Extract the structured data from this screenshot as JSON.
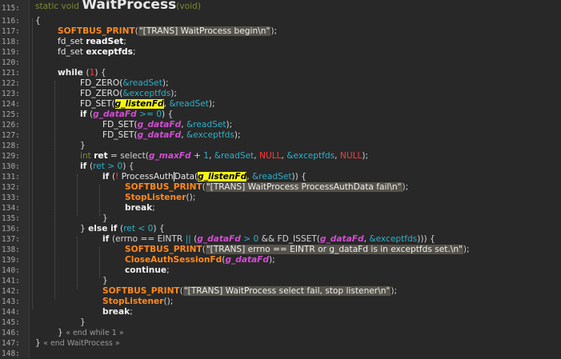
{
  "editor": {
    "colors": {
      "background": "#282828",
      "macro": "#ff8a1e",
      "global_var": "#d24dd2",
      "address": "#2eb0c9",
      "null": "#ff3a3a",
      "highlight": "#f5f513"
    },
    "lines": [
      {
        "num": "115:",
        "indent": 0,
        "tokens": [
          [
            "tk",
            "static void "
          ],
          [
            "fn",
            "WaitProcess"
          ],
          [
            "tk",
            "(void)"
          ]
        ]
      },
      {
        "num": "116:",
        "indent": 0,
        "tokens": [
          [
            "p",
            "{"
          ]
        ]
      },
      {
        "num": "117:",
        "indent": 1,
        "tokens": [
          [
            "m",
            "SOFTBUS_PRINT"
          ],
          [
            "p",
            "("
          ],
          [
            "s",
            "\"[TRANS] WaitProcess begin\\n\""
          ],
          [
            "p",
            ");"
          ]
        ]
      },
      {
        "num": "118:",
        "indent": 1,
        "tokens": [
          [
            "t",
            "fd_set "
          ],
          [
            "v",
            "readSet"
          ],
          [
            "p",
            ";"
          ]
        ]
      },
      {
        "num": "119:",
        "indent": 1,
        "tokens": [
          [
            "t",
            "fd_set "
          ],
          [
            "v",
            "exceptfds"
          ],
          [
            "p",
            ";"
          ]
        ]
      },
      {
        "num": "120:",
        "indent": 0,
        "tokens": []
      },
      {
        "num": "121:",
        "indent": 1,
        "tokens": [
          [
            "k",
            "while "
          ],
          [
            "p",
            "("
          ],
          [
            "n",
            "1"
          ],
          [
            "p",
            ") {"
          ]
        ]
      },
      {
        "num": "122:",
        "indent": 2,
        "tokens": [
          [
            "t",
            "FD_ZERO("
          ],
          [
            "a",
            "&readSet"
          ],
          [
            "p",
            ");"
          ]
        ]
      },
      {
        "num": "123:",
        "indent": 2,
        "tokens": [
          [
            "t",
            "FD_ZERO("
          ],
          [
            "a",
            "&exceptfds"
          ],
          [
            "p",
            ");"
          ]
        ]
      },
      {
        "num": "124:",
        "indent": 2,
        "tokens": [
          [
            "t",
            "FD_SET("
          ],
          [
            "hl-g",
            "g_listenFd"
          ],
          [
            "p",
            ", "
          ],
          [
            "a",
            "&readSet"
          ],
          [
            "p",
            ");"
          ]
        ]
      },
      {
        "num": "125:",
        "indent": 2,
        "tokens": [
          [
            "k",
            "if "
          ],
          [
            "p",
            "("
          ],
          [
            "g",
            "g_dataFd"
          ],
          [
            "a",
            " >= 0"
          ],
          [
            "p",
            ") {"
          ]
        ]
      },
      {
        "num": "126:",
        "indent": 3,
        "tokens": [
          [
            "t",
            "FD_SET("
          ],
          [
            "g",
            "g_dataFd"
          ],
          [
            "p",
            ", "
          ],
          [
            "a",
            "&readSet"
          ],
          [
            "p",
            ");"
          ]
        ]
      },
      {
        "num": "127:",
        "indent": 3,
        "tokens": [
          [
            "t",
            "FD_SET("
          ],
          [
            "g",
            "g_dataFd"
          ],
          [
            "p",
            ", "
          ],
          [
            "a",
            "&exceptfds"
          ],
          [
            "p",
            ");"
          ]
        ]
      },
      {
        "num": "128:",
        "indent": 2,
        "tokens": [
          [
            "p",
            "}"
          ]
        ]
      },
      {
        "num": "129:",
        "indent": 2,
        "tokens": [
          [
            "tk",
            "int "
          ],
          [
            "v",
            "ret"
          ],
          [
            "p",
            " = select("
          ],
          [
            "g",
            "g_maxFd"
          ],
          [
            "p",
            " + "
          ],
          [
            "a",
            "1"
          ],
          [
            "p",
            ", "
          ],
          [
            "a",
            "&readSet"
          ],
          [
            "p",
            ", "
          ],
          [
            "n",
            "NULL"
          ],
          [
            "p",
            ", "
          ],
          [
            "a",
            "&exceptfds"
          ],
          [
            "p",
            ", "
          ],
          [
            "n",
            "NULL"
          ],
          [
            "p",
            ");"
          ]
        ]
      },
      {
        "num": "130:",
        "indent": 2,
        "tokens": [
          [
            "k",
            "if "
          ],
          [
            "p",
            "("
          ],
          [
            "a",
            "ret > 0"
          ],
          [
            "p",
            ") {"
          ]
        ]
      },
      {
        "num": "131:",
        "indent": 3,
        "tokens": [
          [
            "k",
            "if "
          ],
          [
            "p",
            "("
          ],
          [
            "n",
            "! "
          ],
          [
            "pd",
            "ProcessAuth"
          ],
          [
            "caret",
            ""
          ],
          [
            "pd",
            "Data("
          ],
          [
            "hl-g",
            "g_listenFd"
          ],
          [
            "p",
            ", "
          ],
          [
            "a",
            "&readSet"
          ],
          [
            "p",
            ")) {"
          ]
        ]
      },
      {
        "num": "132:",
        "indent": 4,
        "tokens": [
          [
            "m",
            "SOFTBUS_PRINT"
          ],
          [
            "p",
            "("
          ],
          [
            "s",
            "\"[TRANS] WaitProcess ProcessAuthData fail\\n\""
          ],
          [
            "p",
            ");"
          ]
        ]
      },
      {
        "num": "133:",
        "indent": 4,
        "tokens": [
          [
            "m",
            "StopListener"
          ],
          [
            "p",
            "();"
          ]
        ]
      },
      {
        "num": "134:",
        "indent": 4,
        "tokens": [
          [
            "k",
            "break"
          ],
          [
            "p",
            ";"
          ]
        ]
      },
      {
        "num": "135:",
        "indent": 3,
        "tokens": [
          [
            "p",
            "}"
          ]
        ]
      },
      {
        "num": "136:",
        "indent": 2,
        "tokens": [
          [
            "p",
            "} "
          ],
          [
            "k",
            "else if "
          ],
          [
            "p",
            "("
          ],
          [
            "a",
            "ret < 0"
          ],
          [
            "p",
            ") {"
          ]
        ]
      },
      {
        "num": "137:",
        "indent": 3,
        "tokens": [
          [
            "k",
            "if "
          ],
          [
            "p",
            "(errno == EINTR "
          ],
          [
            "a",
            "|| "
          ],
          [
            "p",
            "("
          ],
          [
            "g",
            "g_dataFd"
          ],
          [
            "a",
            " > 0 "
          ],
          [
            "p",
            "&& FD_ISSET("
          ],
          [
            "g",
            "g_dataFd"
          ],
          [
            "p",
            ", "
          ],
          [
            "a",
            "&exceptfds"
          ],
          [
            "p",
            "))) {"
          ]
        ]
      },
      {
        "num": "138:",
        "indent": 4,
        "tokens": [
          [
            "m",
            "SOFTBUS_PRINT"
          ],
          [
            "p",
            "("
          ],
          [
            "s",
            "\"[TRANS] errno == EINTR or g_dataFd is in exceptfds set.\\n\""
          ],
          [
            "p",
            ");"
          ]
        ]
      },
      {
        "num": "139:",
        "indent": 4,
        "tokens": [
          [
            "m",
            "CloseAuthSessionFd"
          ],
          [
            "p",
            "("
          ],
          [
            "g",
            "g_dataFd"
          ],
          [
            "p",
            ");"
          ]
        ]
      },
      {
        "num": "140:",
        "indent": 4,
        "tokens": [
          [
            "k",
            "continue"
          ],
          [
            "p",
            ";"
          ]
        ]
      },
      {
        "num": "141:",
        "indent": 3,
        "tokens": [
          [
            "p",
            "}"
          ]
        ]
      },
      {
        "num": "142:",
        "indent": 3,
        "tokens": [
          [
            "m",
            "SOFTBUS_PRINT"
          ],
          [
            "p",
            "("
          ],
          [
            "s",
            "\"[TRANS] WaitProcess select fail, stop listener\\n\""
          ],
          [
            "p",
            ");"
          ]
        ]
      },
      {
        "num": "143:",
        "indent": 3,
        "tokens": [
          [
            "m",
            "StopListener"
          ],
          [
            "p",
            "();"
          ]
        ]
      },
      {
        "num": "144:",
        "indent": 3,
        "tokens": [
          [
            "k",
            "break"
          ],
          [
            "p",
            ";"
          ]
        ]
      },
      {
        "num": "145:",
        "indent": 2,
        "tokens": [
          [
            "p",
            "}"
          ]
        ]
      },
      {
        "num": "146:",
        "indent": 1,
        "tokens": [
          [
            "p",
            "} "
          ],
          [
            "c",
            "« end while 1 »"
          ]
        ]
      },
      {
        "num": "147:",
        "indent": 0,
        "tokens": [
          [
            "p",
            "} "
          ],
          [
            "c",
            "« end WaitProcess »"
          ]
        ]
      },
      {
        "num": "148:",
        "indent": 0,
        "tokens": []
      }
    ]
  }
}
